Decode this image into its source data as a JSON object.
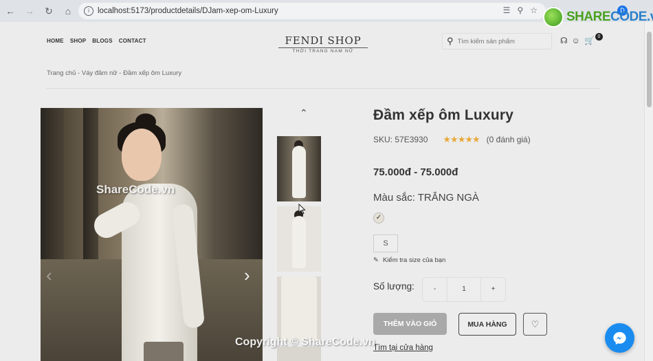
{
  "browser": {
    "url": "localhost:5173/productdetails/DJam-xep-om-Luxury",
    "profile_initial": "D"
  },
  "watermark": {
    "logo_share": "SHARE",
    "logo_code": "CODE.vn",
    "image_text": "ShareCode.vn",
    "copyright": "Copyright © ShareCode.vn"
  },
  "header": {
    "nav": [
      "HOME",
      "SHOP",
      "BLOGS",
      "CONTACT"
    ],
    "brand_name": "FENDI SHOP",
    "brand_tagline": "THỜI TRANG NAM NỮ",
    "search_placeholder": "Tìm kiếm sản phẩm",
    "cart_count": "0"
  },
  "breadcrumb": "Trang chủ - Váy đầm nữ - Đầm xếp ôm Luxury",
  "product": {
    "title": "Đầm xếp ôm Luxury",
    "sku": "SKU: 57E3930",
    "stars": "★★★★★",
    "reviews": "(0 đánh giá)",
    "price": "75.000đ - 75.000đ",
    "color_label": "Màu sắc: TRẮNG NGÀ",
    "size": "S",
    "size_check": "Kiểm tra size của bạn",
    "qty_label": "Số lượng:",
    "qty_minus": "-",
    "qty_value": "1",
    "qty_plus": "+",
    "add_to_cart": "THÊM VÀO GIỎ",
    "buy": "MUA HÀNG",
    "store_link": "Tìm tại cửa hàng"
  },
  "colors": {
    "accent_star": "#e8a93a",
    "button_grey": "#a9a9a9",
    "messenger": "#1a8cf0"
  }
}
